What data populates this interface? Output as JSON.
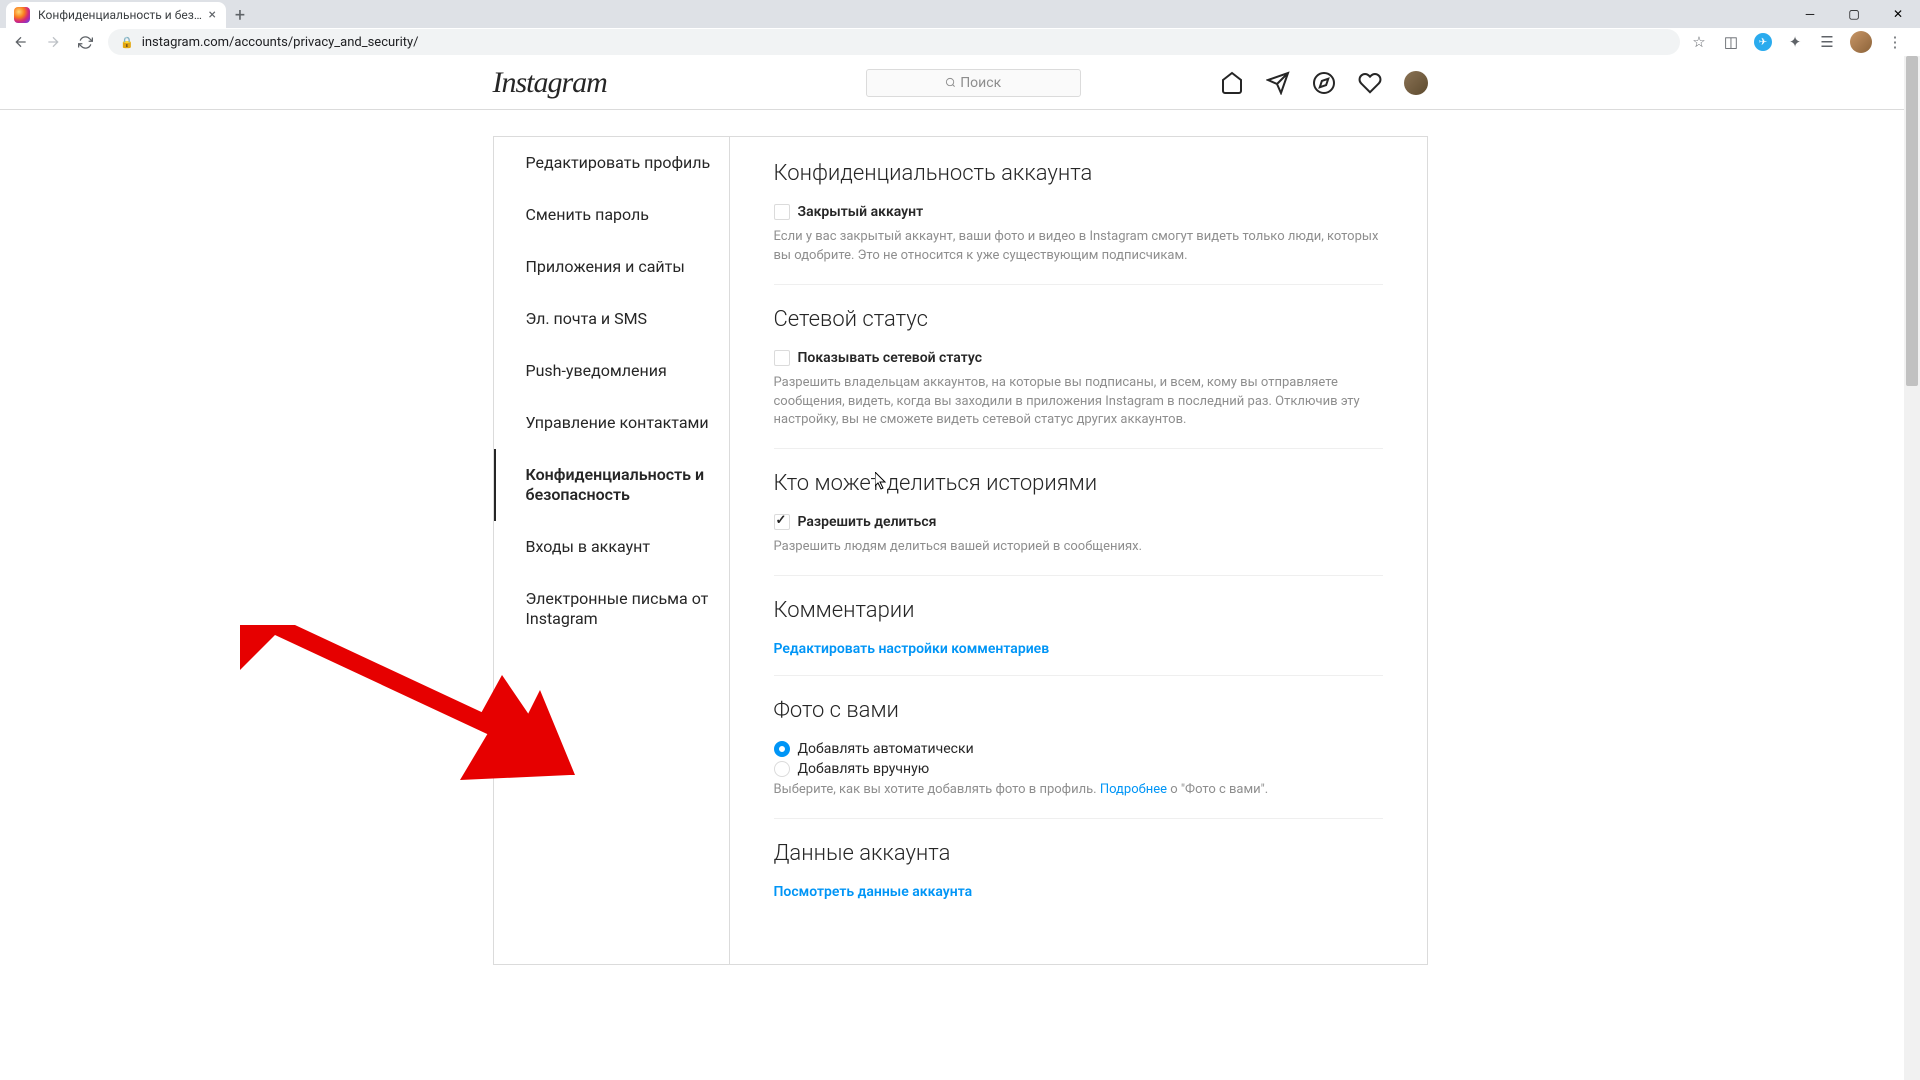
{
  "browser": {
    "tab_title": "Конфиденциальность и безопа",
    "url": "instagram.com/accounts/privacy_and_security/"
  },
  "header": {
    "logo": "Instagram",
    "search_placeholder": "Поиск"
  },
  "sidebar": {
    "items": [
      {
        "label": "Редактировать профиль"
      },
      {
        "label": "Сменить пароль"
      },
      {
        "label": "Приложения и сайты"
      },
      {
        "label": "Эл. почта и SMS"
      },
      {
        "label": "Push-уведомления"
      },
      {
        "label": "Управление контактами"
      },
      {
        "label": "Конфиденциальность и безопасность"
      },
      {
        "label": "Входы в аккаунт"
      },
      {
        "label": "Электронные письма от Instagram"
      }
    ],
    "active_index": 6
  },
  "sections": {
    "privacy": {
      "title": "Конфиденциальность аккаунта",
      "checkbox_label": "Закрытый аккаунт",
      "desc": "Если у вас закрытый аккаунт, ваши фото и видео в Instagram смогут видеть только люди, которых вы одобрите. Это не относится к уже существующим подписчикам."
    },
    "activity": {
      "title": "Сетевой статус",
      "checkbox_label": "Показывать сетевой статус",
      "desc": "Разрешить владельцам аккаунтов, на которые вы подписаны, и всем, кому вы отправляете сообщения, видеть, когда вы заходили в приложения Instagram в последний раз. Отключив эту настройку, вы не сможете видеть сетевой статус других аккаунтов."
    },
    "stories": {
      "title": "Кто может делиться историями",
      "checkbox_label": "Разрешить делиться",
      "desc": "Разрешить людям делиться вашей историей в сообщениях."
    },
    "comments": {
      "title": "Комментарии",
      "link": "Редактировать настройки комментариев"
    },
    "photos": {
      "title": "Фото с вами",
      "radio1": "Добавлять автоматически",
      "radio2": "Добавлять вручную",
      "desc_pre": "Выберите, как вы хотите добавлять фото в профиль. ",
      "desc_link": "Подробнее",
      "desc_post": " о \"Фото с вами\"."
    },
    "data": {
      "title": "Данные аккаунта",
      "link": "Посмотреть данные аккаунта"
    }
  }
}
